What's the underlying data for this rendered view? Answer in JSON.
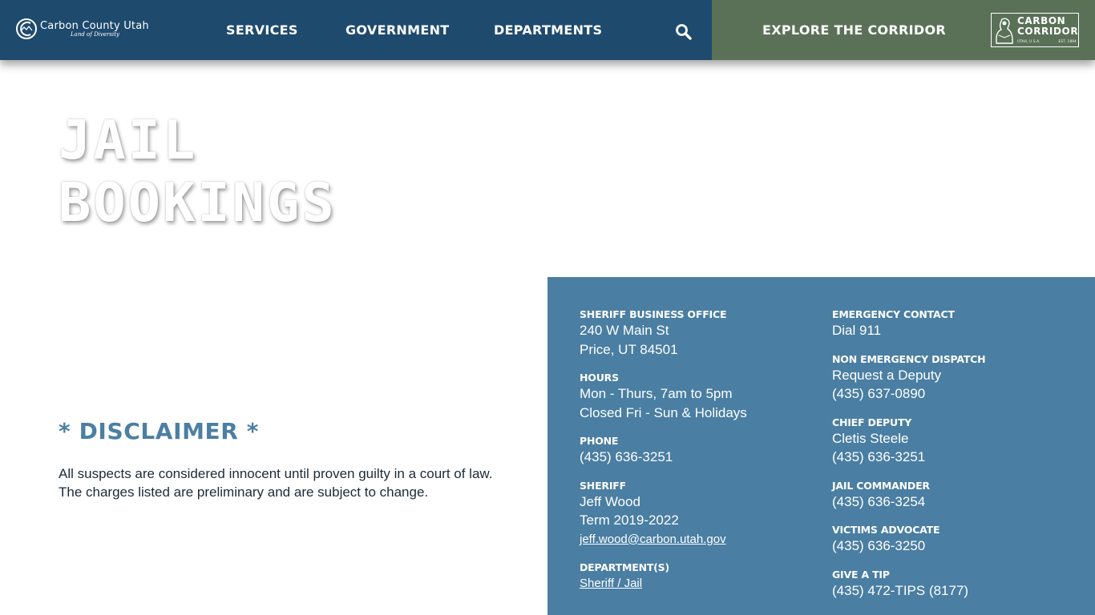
{
  "header": {
    "logo": {
      "name": "Carbon County Utah",
      "tagline": "Land of Diversity"
    },
    "nav": [
      "SERVICES",
      "GOVERNMENT",
      "DEPARTMENTS"
    ],
    "explore_label": "EXPLORE THE CORRIDOR",
    "corridor_badge": {
      "line1": "CARBON",
      "line2": "CORRIDOR",
      "sub_left": "UTAH, U.S.A.",
      "sub_right": "EST. 1894"
    },
    "colors": {
      "nav_bg": "#1e4a6e",
      "corridor_bg": "#5a7158"
    }
  },
  "page": {
    "title_line1": "JAIL",
    "title_line2": "BOOKINGS"
  },
  "disclaimer": {
    "title": "* DISCLAIMER *",
    "line1": "All suspects are considered innocent until proven guilty in a court of law.",
    "line2": "The charges listed are preliminary and are subject to change.",
    "color": "#4b7fa3"
  },
  "info": {
    "panel_color": "#4a7ea3",
    "left": {
      "office_label": "SHERIFF BUSINESS OFFICE",
      "office_addr1": "240 W Main St",
      "office_addr2": "Price, UT 84501",
      "hours_label": "HOURS",
      "hours1": "Mon - Thurs, 7am to 5pm",
      "hours2": "Closed Fri - Sun & Holidays",
      "phone_label": "PHONE",
      "phone": "(435) 636-3251",
      "sheriff_label": "SHERIFF",
      "sheriff_name": "Jeff Wood",
      "sheriff_term": "Term 2019-2022",
      "sheriff_email": "jeff.wood@carbon.utah.gov",
      "departments_label": "DEPARTMENT(S)",
      "department_link": "Sheriff / Jail"
    },
    "right": {
      "emergency_label": "EMERGENCY CONTACT",
      "emergency": "Dial 911",
      "dispatch_label": "NON EMERGENCY DISPATCH",
      "dispatch1": "Request a Deputy",
      "dispatch2": "(435) 637-0890",
      "chief_label": "CHIEF DEPUTY",
      "chief_name": "Cletis Steele",
      "chief_phone": "(435) 636-3251",
      "jail_label": "JAIL COMMANDER",
      "jail_phone": "(435) 636-3254",
      "victims_label": "VICTIMS ADVOCATE",
      "victims_phone": "(435) 636-3250",
      "tip_label": "GIVE A TIP",
      "tip_phone": "(435) 472-TIPS (8177)"
    }
  }
}
